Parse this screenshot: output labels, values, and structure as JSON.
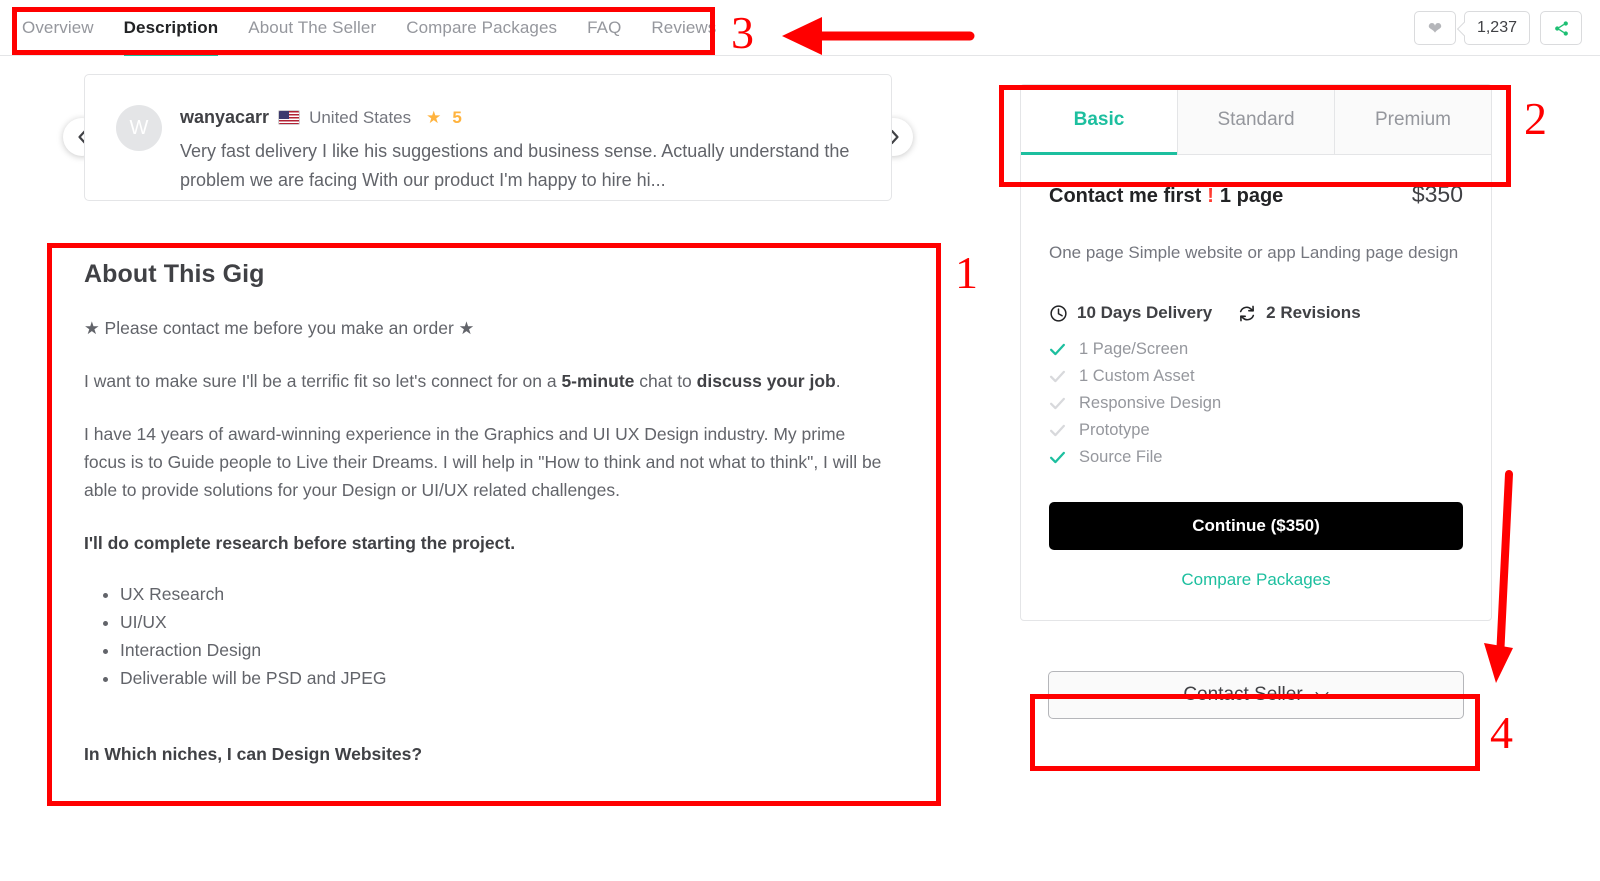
{
  "nav": {
    "tabs": [
      {
        "label": "Overview",
        "active": false
      },
      {
        "label": "Description",
        "active": true
      },
      {
        "label": "About The Seller",
        "active": false
      },
      {
        "label": "Compare Packages",
        "active": false
      },
      {
        "label": "FAQ",
        "active": false
      },
      {
        "label": "Reviews",
        "active": false
      }
    ],
    "favorite_count": "1,237",
    "heart_icon": "heart-icon",
    "share_icon": "share-icon"
  },
  "review": {
    "avatar_initial": "W",
    "username": "wanyacarr",
    "country": "United States",
    "flag_icon": "us-flag-icon",
    "star_icon": "★",
    "rating": "5",
    "text": "Very fast delivery I like his suggestions and business sense. Actually understand the problem we are facing With our product I'm happy to hire hi...",
    "prev_icon": "chevron-left-icon",
    "next_icon": "chevron-right-icon"
  },
  "about": {
    "heading": "About This Gig",
    "line_contact": "★ Please contact me before you make an order ★",
    "para2_a": "I want to make sure I'll be a terrific fit so let's connect for on a ",
    "para2_b": "5-minute",
    "para2_c": " chat to ",
    "para2_d": "discuss your job",
    "para2_e": ".",
    "para3": "I have 14 years of award-winning experience in the Graphics and UI UX Design industry. My prime focus is to Guide people to Live their Dreams. I will help in \"How to think and not what to think\", I will be able to provide solutions for your Design or UI/UX related challenges.",
    "para4": "I'll do complete research before starting the project.",
    "bullets": [
      "UX Research",
      "UI/UX",
      "Interaction Design",
      "Deliverable will be PSD and JPEG"
    ],
    "niche_heading": "In Which niches, I can Design Websites?"
  },
  "package": {
    "tabs": [
      {
        "label": "Basic",
        "active": true
      },
      {
        "label": "Standard",
        "active": false
      },
      {
        "label": "Premium",
        "active": false
      }
    ],
    "title_main": "Contact me first",
    "title_excl": "!",
    "title_sub": "1 page",
    "price": "$350",
    "description": "One page Simple website or app Landing page design",
    "delivery": "10 Days Delivery",
    "delivery_icon": "clock-icon",
    "revisions": "2 Revisions",
    "revisions_icon": "refresh-icon",
    "features": [
      {
        "label": "1 Page/Screen",
        "included": true
      },
      {
        "label": "1 Custom Asset",
        "included": false
      },
      {
        "label": "Responsive Design",
        "included": false
      },
      {
        "label": "Prototype",
        "included": false
      },
      {
        "label": "Source File",
        "included": true
      }
    ],
    "continue_label": "Continue ($350)",
    "compare_label": "Compare Packages",
    "contact_label": "Contact Seller",
    "contact_chevron_icon": "chevron-down-icon"
  },
  "annotations": {
    "numbers": [
      "1",
      "2",
      "3",
      "4"
    ],
    "color": "#ff0000"
  },
  "colors": {
    "accent_teal": "#1dbf9f",
    "annotation_red": "#ff0000",
    "star_orange": "#ffb33e",
    "cta_black": "#000000"
  }
}
